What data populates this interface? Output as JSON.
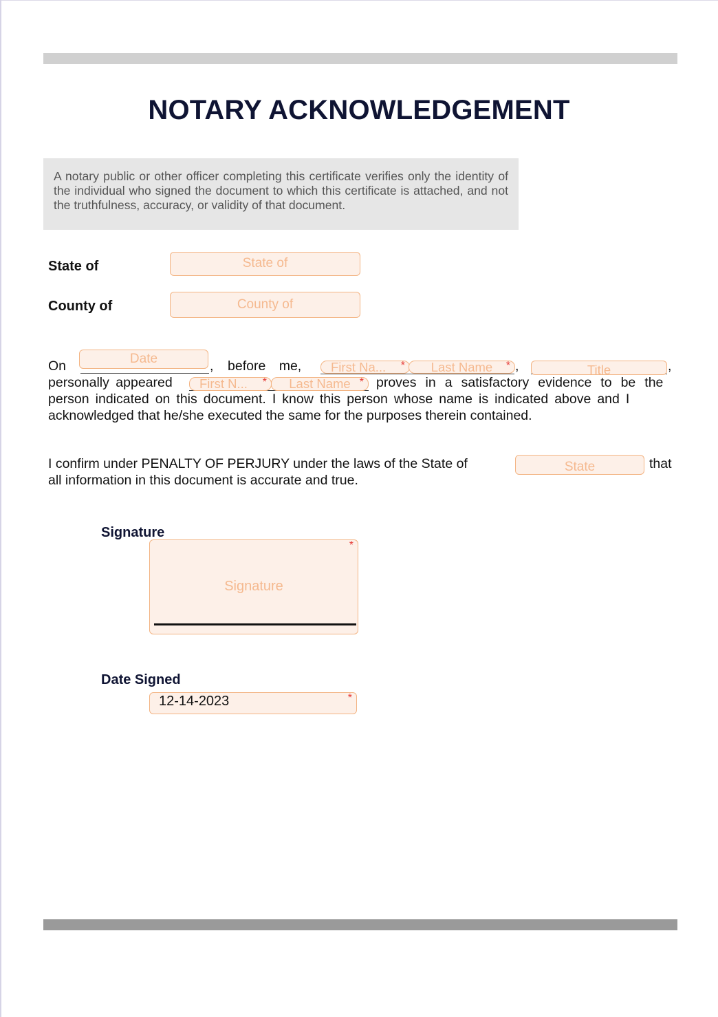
{
  "document": {
    "title": "NOTARY ACKNOWLEDGEMENT",
    "disclaimer": "A notary public or other officer completing this certificate verifies only the identity of the individual who signed the document to which this certificate is attached, and not the truthfulness, accuracy, or validity of that document."
  },
  "location": {
    "state_label": "State of",
    "state_placeholder": "State of",
    "county_label": "County of",
    "county_placeholder": "County of"
  },
  "acknowledgement": {
    "on_text": "On",
    "date_placeholder": "Date",
    "comma1": ",",
    "before_me_text": "before me,",
    "officer_first_placeholder": "First Na...",
    "officer_last_placeholder": "Last Name",
    "comma2": ",",
    "title_placeholder": "Title",
    "comma3": ",",
    "personally_appeared_text": "personally appeared",
    "signer_first_placeholder": "First N...",
    "signer_last_placeholder": "Last Name",
    "proves_text": "proves in a satisfactory evidence to be the",
    "line3": "person indicated on this document. I know this person whose name is indicated above and I",
    "line4": "acknowledged that he/she executed the same for the purposes therein contained.",
    "required_marker": "*"
  },
  "perjury": {
    "text_before": "I confirm under PENALTY OF PERJURY under the laws of the State of",
    "state_placeholder": "State",
    "text_after": "that",
    "line2": "all information in this document is accurate and true."
  },
  "signature": {
    "label": "Signature",
    "placeholder": "Signature",
    "required_marker": "*"
  },
  "date_signed": {
    "label": "Date Signed",
    "value": "12-14-2023",
    "required_marker": "*"
  }
}
